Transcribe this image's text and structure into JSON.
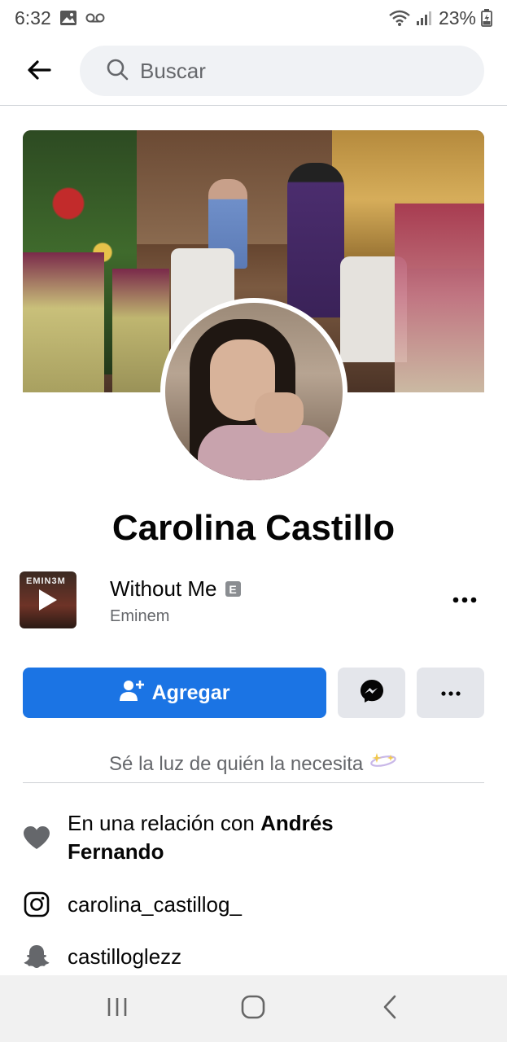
{
  "status_bar": {
    "time": "6:32",
    "battery": "23%"
  },
  "search": {
    "placeholder": "Buscar"
  },
  "profile": {
    "name": "Carolina Castillo"
  },
  "music": {
    "album_label": "EMIN3M",
    "title": "Without Me",
    "explicit_badge": "E",
    "artist": "Eminem"
  },
  "actions": {
    "add_label": "Agregar"
  },
  "bio": "Sé la luz de quién la necesita",
  "details": {
    "relationship_prefix": "En una relación con",
    "relationship_partner": "Andrés Fernando",
    "instagram": "carolina_castillog_",
    "snapchat": "castilloglezz"
  },
  "colors": {
    "primary_button": "#1b74e4",
    "secondary_button": "#e4e6eb",
    "muted_text": "#65676b"
  },
  "icons": {
    "back": "arrow-left-icon",
    "search": "search-icon",
    "add_friend": "person-plus-icon",
    "messenger": "messenger-icon",
    "more": "more-horizontal-icon",
    "relationship": "heart-icon",
    "instagram": "instagram-icon",
    "snapchat": "snapchat-icon"
  }
}
